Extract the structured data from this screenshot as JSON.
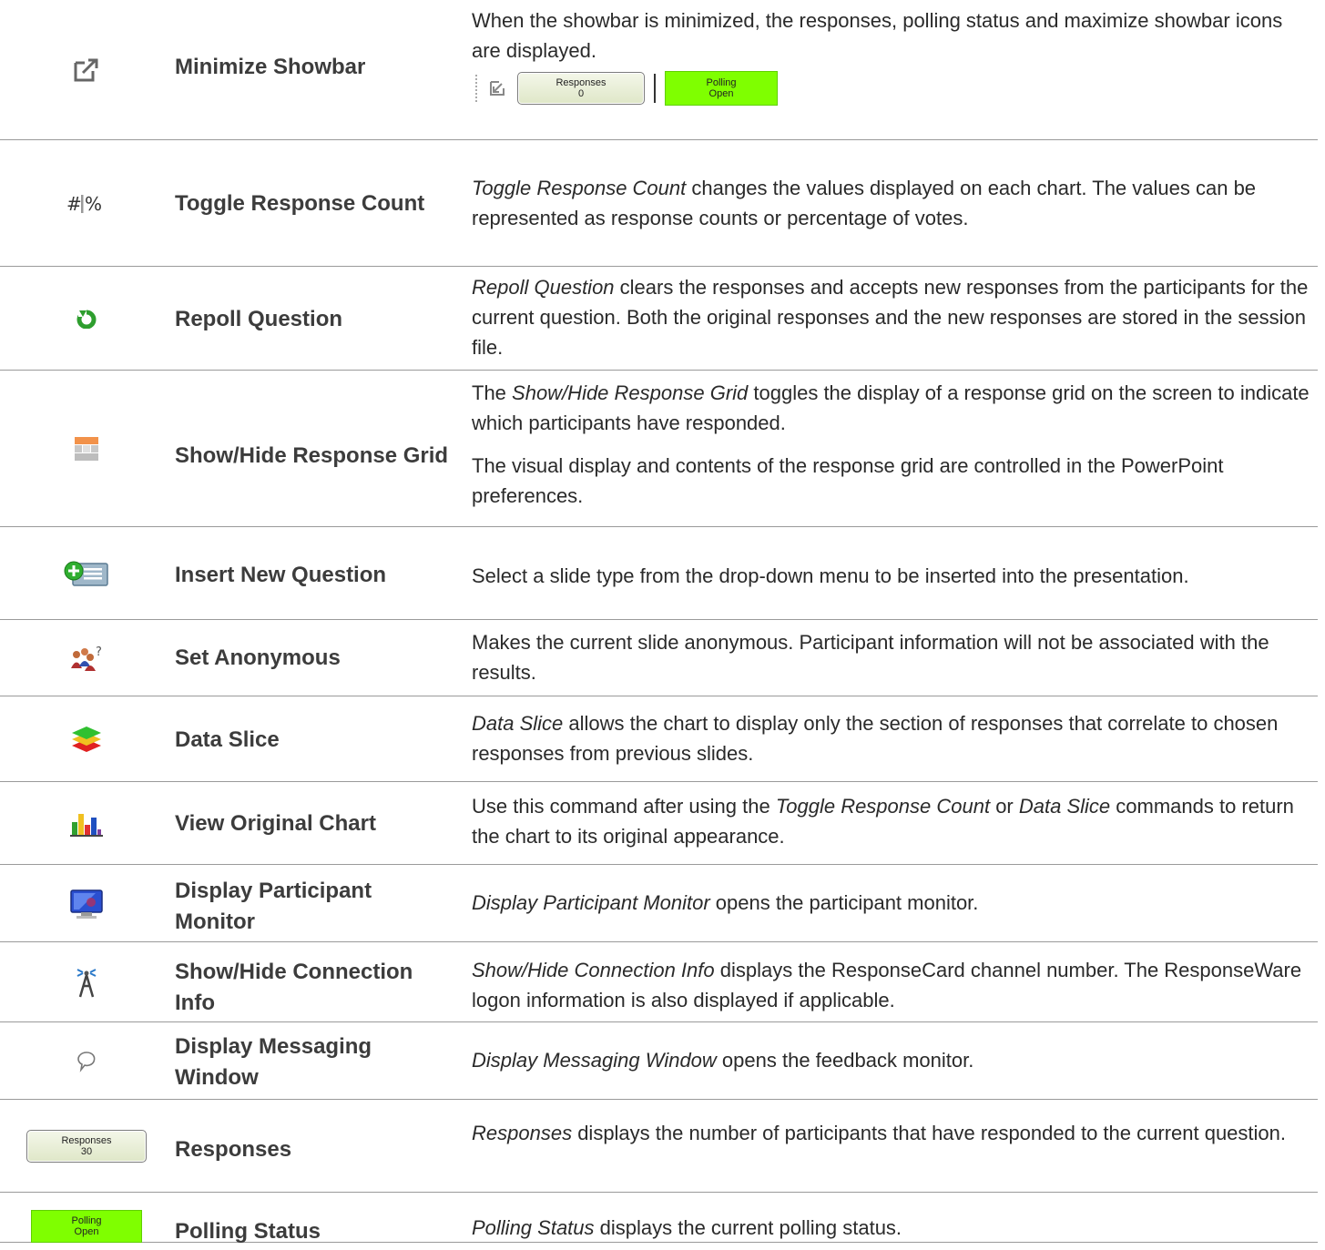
{
  "rows": [
    {
      "name": "Minimize Showbar",
      "icon": "minimize-arrow-icon",
      "desc1": "When the showbar is minimized, the responses, polling status and maximize showbar icons are displayed.",
      "mini_responses_label": "Responses",
      "mini_responses_count": "0",
      "mini_polling_label": "Polling",
      "mini_polling_state": "Open"
    },
    {
      "name": "Toggle Response Count",
      "icon": "hash-percent-icon",
      "desc_em": "Toggle Response Count",
      "desc": " changes the values displayed on each chart. The values can be represented as response counts or percentage of votes."
    },
    {
      "name": "Repoll Question",
      "icon": "repoll-icon",
      "desc_em": "Repoll Question",
      "desc": " clears the responses and accepts new responses from the participants for the current question. Both the original responses and the new responses are stored in the session file."
    },
    {
      "name": "Show/Hide Response Grid",
      "icon": "response-grid-icon",
      "desc_pre": "The ",
      "desc_em": "Show/Hide Response Grid",
      "desc": " toggles the display of a response grid on the screen to indicate which participants have responded.",
      "desc2": "The visual display and contents of the response grid are controlled in the PowerPoint preferences."
    },
    {
      "name": "Insert New Question",
      "icon": "insert-question-icon",
      "desc": "Select a slide type from the drop-down menu to be inserted into the presentation."
    },
    {
      "name": "Set Anonymous",
      "icon": "anonymous-users-icon",
      "desc": "Makes the current slide anonymous. Participant information will not be associated with the results."
    },
    {
      "name": "Data Slice",
      "icon": "data-slice-icon",
      "desc_em": "Data Slice",
      "desc": " allows the chart to display only the section of responses that correlate to chosen responses from previous slides."
    },
    {
      "name": "View Original Chart",
      "icon": "bar-chart-icon",
      "desc_pre": "Use this command after using the ",
      "desc_em": "Toggle Response Count",
      "desc_mid": " or ",
      "desc_em2": "Data Slice",
      "desc": " commands to return the chart to its original appearance."
    },
    {
      "name": "Display Participant Monitor",
      "icon": "monitor-icon",
      "desc_em": "Display Participant Monitor",
      "desc": " opens the participant monitor."
    },
    {
      "name": "Show/Hide Connection Info",
      "icon": "antenna-icon",
      "desc_em": "Show/Hide Connection Info",
      "desc": " displays the ResponseCard channel number. The ResponseWare logon information is also displayed if applicable."
    },
    {
      "name": "Display Messaging Window",
      "icon": "speech-bubble-icon",
      "desc_em": "Display Messaging Window",
      "desc": " opens the feedback monitor."
    },
    {
      "name": "Responses",
      "icon": "responses-button-icon",
      "btn_label": "Responses",
      "btn_count": "30",
      "desc_em": "Responses",
      "desc": " displays the number of participants that have responded to the current question."
    },
    {
      "name": "Polling Status",
      "icon": "polling-status-icon",
      "btn_label": "Polling",
      "btn_state": "Open",
      "desc_em": "Polling Status",
      "desc": " displays the current polling status."
    }
  ],
  "colors": {
    "polling_green": "#7fff00",
    "repoll_green": "#2e9e2e",
    "rule": "#9a9a9a"
  }
}
